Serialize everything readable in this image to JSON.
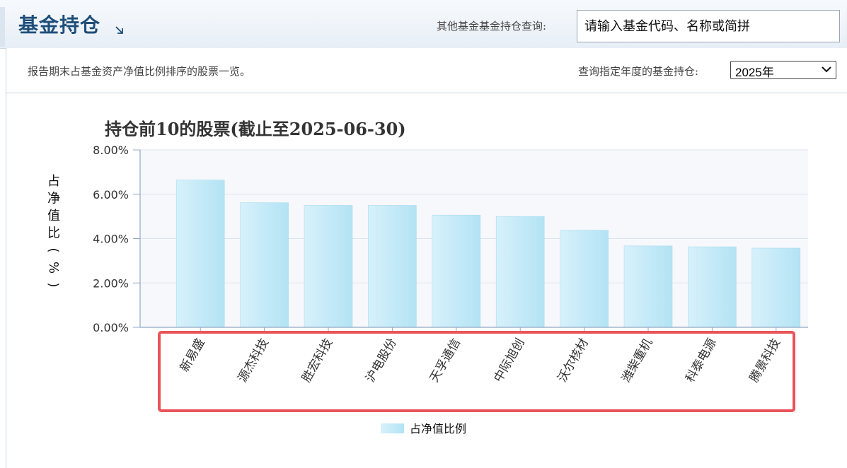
{
  "header": {
    "title": "基金持仓",
    "search_label": "其他基金基金持仓查询:",
    "search_placeholder": "请输入基金代码、名称或简拼"
  },
  "subbar": {
    "description": "报告期末占基金资产净值比例排序的股票一览。",
    "year_label": "查询指定年度的基金持仓:",
    "year_selected": "2025年"
  },
  "icons": {
    "expand": "expand-arrow-icon",
    "dropdown": "chevron-down-icon"
  },
  "colors": {
    "bar": "#c8ecf8",
    "bar_edge": "#9fd8ef",
    "highlight": "#e9545a",
    "title": "#1f4e79"
  },
  "chart_data": {
    "type": "bar",
    "title": "持仓前10的股票(截止至2025-06-30)",
    "ylabel": "占净值比(%)",
    "xlabel": "",
    "ylim": [
      0,
      8
    ],
    "yticks": [
      "0.00%",
      "2.00%",
      "4.00%",
      "6.00%",
      "8.00%"
    ],
    "categories": [
      "新易盛",
      "源杰科技",
      "胜宏科技",
      "沪电股份",
      "天孚通信",
      "中际旭创",
      "沃尔核材",
      "潍柴重机",
      "科泰电源",
      "腾景科技"
    ],
    "series": [
      {
        "name": "占净值比例",
        "values": [
          6.64,
          5.62,
          5.5,
          5.5,
          5.06,
          5.0,
          4.38,
          3.67,
          3.63,
          3.57
        ]
      }
    ],
    "grid": true,
    "legend": "bottom-center"
  }
}
